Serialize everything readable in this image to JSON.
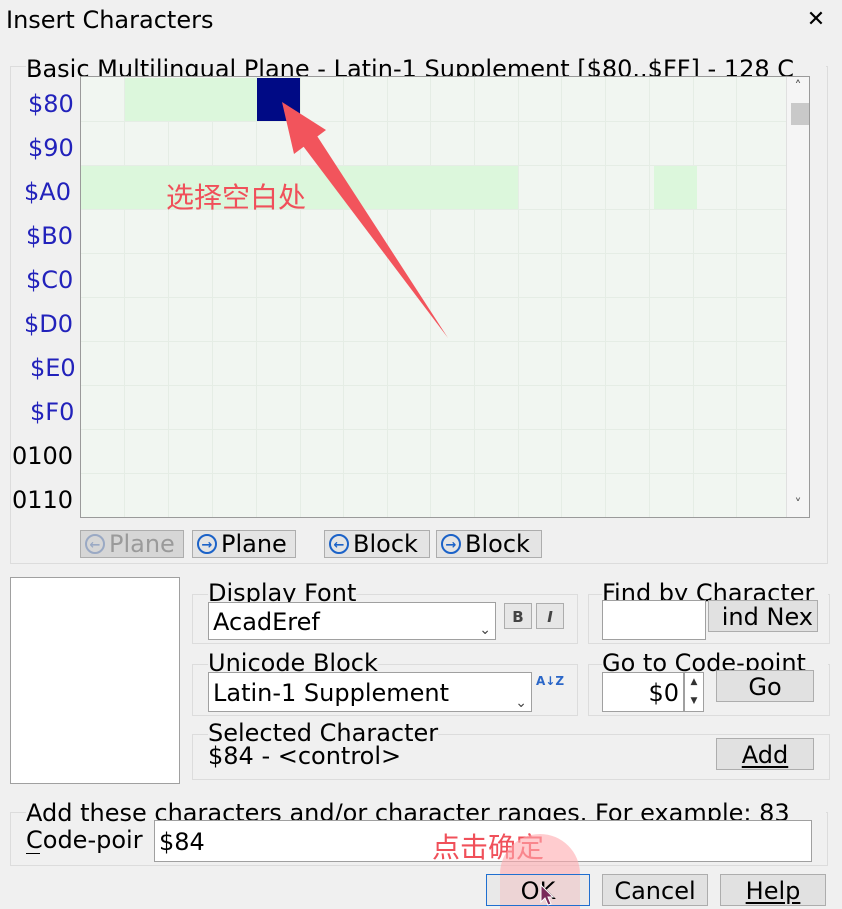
{
  "window": {
    "title": "Insert Characters",
    "close": "✕"
  },
  "grid": {
    "caption": "Basic Multilingual Plane - Latin-1 Supplement [$80..$FF] - 128 C",
    "rows": [
      "$80",
      "$90",
      "$A0",
      "$B0",
      "$C0",
      "$D0",
      "$E0",
      "$F0",
      "0100",
      "0110"
    ],
    "selected_code": "$84",
    "scroll_up": "˄",
    "scroll_down": "˅"
  },
  "nav": {
    "prev_plane": "Plane",
    "next_plane": "Plane",
    "prev_block": "Block",
    "next_block": "Block"
  },
  "display_font": {
    "label": "Display Font",
    "value": "AcadEref",
    "bold": "B",
    "italic": "I"
  },
  "unicode_block": {
    "label": "Unicode Block",
    "value": "Latin-1 Supplement",
    "sort_icon": "A↓Z"
  },
  "find": {
    "label": "Find by Character",
    "value": "",
    "button": "ind Nex"
  },
  "goto": {
    "label": "Go to Code-point",
    "value": "$0",
    "button": "Go"
  },
  "selected": {
    "label": "Selected Character",
    "value": "$84 - <control>",
    "add_button": "Add"
  },
  "bottom": {
    "label": "Add these characters and/or character ranges. For example: 83",
    "codepoint_label": "Code-poir",
    "codepoint_value": "$84"
  },
  "buttons": {
    "ok": "OK",
    "cancel": "Cancel",
    "help": "Help"
  },
  "annotations": {
    "select_blank": "选择空白处",
    "click_ok": "点击确定"
  }
}
